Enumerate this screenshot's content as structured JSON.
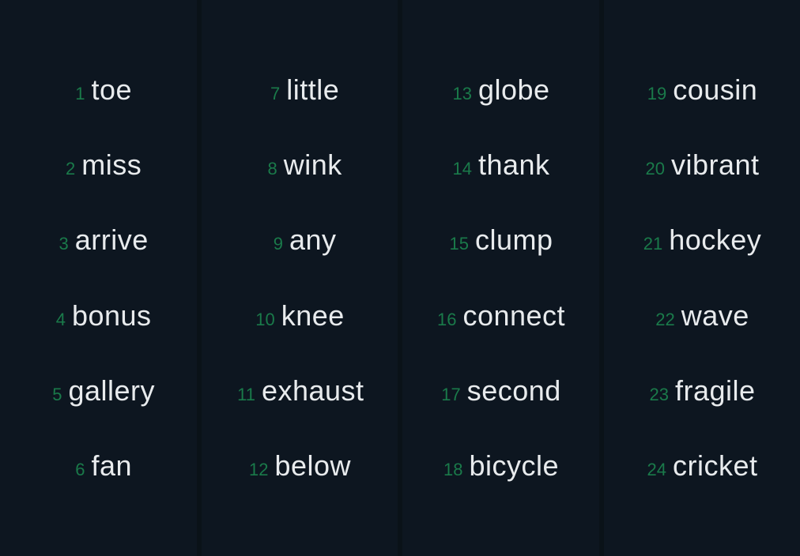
{
  "words": [
    {
      "n": "1",
      "w": "toe"
    },
    {
      "n": "2",
      "w": "miss"
    },
    {
      "n": "3",
      "w": "arrive"
    },
    {
      "n": "4",
      "w": "bonus"
    },
    {
      "n": "5",
      "w": "gallery"
    },
    {
      "n": "6",
      "w": "fan"
    },
    {
      "n": "7",
      "w": "little"
    },
    {
      "n": "8",
      "w": "wink"
    },
    {
      "n": "9",
      "w": "any"
    },
    {
      "n": "10",
      "w": "knee"
    },
    {
      "n": "11",
      "w": "exhaust"
    },
    {
      "n": "12",
      "w": "below"
    },
    {
      "n": "13",
      "w": "globe"
    },
    {
      "n": "14",
      "w": "thank"
    },
    {
      "n": "15",
      "w": "clump"
    },
    {
      "n": "16",
      "w": "connect"
    },
    {
      "n": "17",
      "w": "second"
    },
    {
      "n": "18",
      "w": "bicycle"
    },
    {
      "n": "19",
      "w": "cousin"
    },
    {
      "n": "20",
      "w": "vibrant"
    },
    {
      "n": "21",
      "w": "hockey"
    },
    {
      "n": "22",
      "w": "wave"
    },
    {
      "n": "23",
      "w": "fragile"
    },
    {
      "n": "24",
      "w": "cricket"
    }
  ]
}
